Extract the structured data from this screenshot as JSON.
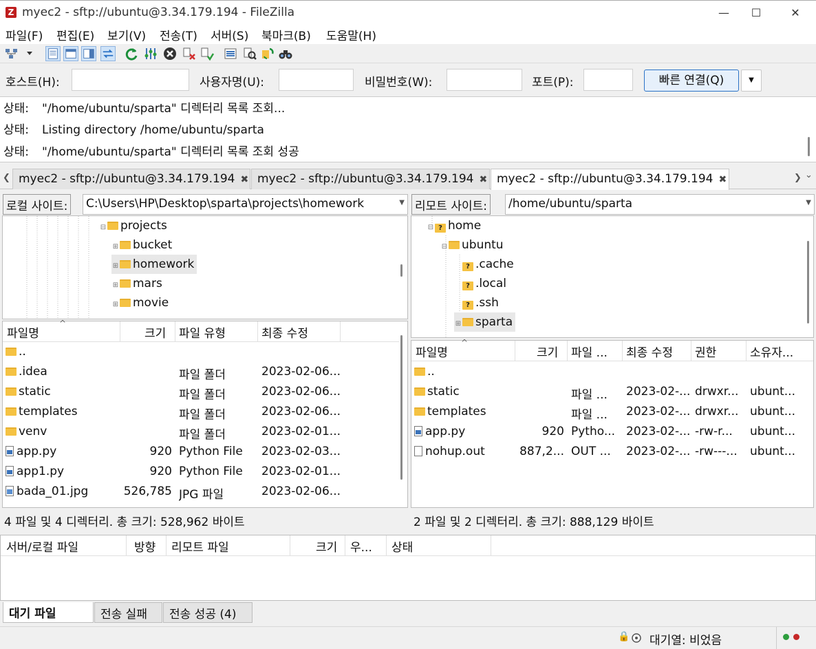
{
  "window": {
    "title": "myec2 - sftp://ubuntu@3.34.179.194 - FileZilla",
    "app_icon_glyph": "Z",
    "minimize": "—",
    "maximize": "☐",
    "close": "✕"
  },
  "menu": [
    "파일(F)",
    "편집(E)",
    "보기(V)",
    "전송(T)",
    "서버(S)",
    "북마크(B)",
    "도움말(H)"
  ],
  "quickconnect": {
    "host_label": "호스트(H):",
    "user_label": "사용자명(U):",
    "pass_label": "비밀번호(W):",
    "port_label": "포트(P):",
    "connect_label": "빠른 연결(Q)",
    "dropdown_glyph": "▼",
    "host_value": "",
    "user_value": "",
    "pass_value": "",
    "port_value": ""
  },
  "log": [
    {
      "key": "상태:",
      "text": "\"/home/ubuntu/sparta\" 디렉터리 목록 조회..."
    },
    {
      "key": "상태:",
      "text": "Listing directory /home/ubuntu/sparta"
    },
    {
      "key": "상태:",
      "text": "\"/home/ubuntu/sparta\" 디렉터리 목록 조회 성공"
    }
  ],
  "tabs": [
    {
      "label": "myec2 - sftp://ubuntu@3.34.179.194",
      "close": "✖"
    },
    {
      "label": "myec2 - sftp://ubuntu@3.34.179.194",
      "close": "✖"
    },
    {
      "label": "myec2 - sftp://ubuntu@3.34.179.194",
      "close": "✖"
    }
  ],
  "tab_nav": {
    "left": "❮",
    "right": "❯",
    "menu": "⌄"
  },
  "local": {
    "site_label": "로컬 사이트:",
    "path": "C:\\Users\\HP\\Desktop\\sparta\\projects\\homework",
    "tree": [
      {
        "label": "projects",
        "exp": "⊟"
      },
      {
        "label": "bucket",
        "exp": "⊞"
      },
      {
        "label": "homework",
        "exp": "⊞"
      },
      {
        "label": "mars",
        "exp": "⊞"
      },
      {
        "label": "movie",
        "exp": "⊞"
      }
    ],
    "headers": {
      "name": "파일명",
      "size": "크기",
      "type": "파일 유형",
      "modified": "최종 수정"
    },
    "sort_glyph": "^",
    "files": [
      {
        "name": "..",
        "size": "",
        "type": "",
        "modified": ""
      },
      {
        "name": ".idea",
        "size": "",
        "type": "파일 폴더",
        "modified": "2023-02-06..."
      },
      {
        "name": "static",
        "size": "",
        "type": "파일 폴더",
        "modified": "2023-02-06..."
      },
      {
        "name": "templates",
        "size": "",
        "type": "파일 폴더",
        "modified": "2023-02-06..."
      },
      {
        "name": "venv",
        "size": "",
        "type": "파일 폴더",
        "modified": "2023-02-01..."
      },
      {
        "name": "app.py",
        "size": "920",
        "type": "Python File",
        "modified": "2023-02-03..."
      },
      {
        "name": "app1.py",
        "size": "920",
        "type": "Python File",
        "modified": "2023-02-01..."
      },
      {
        "name": "bada_01.jpg",
        "size": "526,785",
        "type": "JPG 파일",
        "modified": "2023-02-06..."
      }
    ],
    "status": "4 파일 및 4 디렉터리. 총 크기: 528,962 바이트"
  },
  "remote": {
    "site_label": "리모트 사이트:",
    "path": "/home/ubuntu/sparta",
    "tree": [
      {
        "label": "home",
        "exp": "⊟"
      },
      {
        "label": "ubuntu",
        "exp": "⊟"
      },
      {
        "label": ".cache",
        "exp": ""
      },
      {
        "label": ".local",
        "exp": ""
      },
      {
        "label": ".ssh",
        "exp": ""
      },
      {
        "label": "sparta",
        "exp": "⊞"
      }
    ],
    "headers": {
      "name": "파일명",
      "size": "크기",
      "type": "파일 ...",
      "modified": "최종 수정",
      "perm": "권한",
      "owner": "소유자..."
    },
    "sort_glyph": "^",
    "files": [
      {
        "name": "..",
        "size": "",
        "type": "",
        "modified": "",
        "perm": "",
        "owner": ""
      },
      {
        "name": "static",
        "size": "",
        "type": "파일 ...",
        "modified": "2023-02-...",
        "perm": "drwxr...",
        "owner": "ubunt..."
      },
      {
        "name": "templates",
        "size": "",
        "type": "파일 ...",
        "modified": "2023-02-...",
        "perm": "drwxr...",
        "owner": "ubunt..."
      },
      {
        "name": "app.py",
        "size": "920",
        "type": "Pytho...",
        "modified": "2023-02-...",
        "perm": "-rw-r...",
        "owner": "ubunt..."
      },
      {
        "name": "nohup.out",
        "size": "887,2...",
        "type": "OUT ...",
        "modified": "2023-02-...",
        "perm": "-rw---...",
        "owner": "ubunt..."
      }
    ],
    "status": "2 파일 및 2 디렉터리. 총 크기: 888,129 바이트"
  },
  "queue": {
    "headers": {
      "local": "서버/로컬 파일",
      "dir": "방향",
      "remote": "리모트 파일",
      "size": "크기",
      "prio": "우...",
      "status": "상태"
    },
    "tabs": [
      "대기 파일",
      "전송 실패",
      "전송 성공 (4)"
    ]
  },
  "statusbar": {
    "queue": "대기열: 비었음",
    "lock_glyph": "🔒"
  },
  "colors": {
    "accent": "#2a72c6",
    "folder": "#f5c242",
    "led_green": "#2e9e3e",
    "led_red": "#c62828"
  }
}
